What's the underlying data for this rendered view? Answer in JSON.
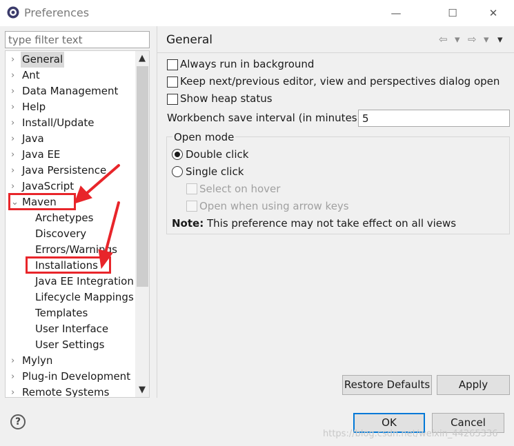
{
  "window": {
    "title": "Preferences",
    "minimize": "—",
    "maximize": "☐",
    "close": "✕"
  },
  "filter": {
    "placeholder": "type filter text"
  },
  "tree": {
    "collapsed_glyph": "›",
    "expanded_glyph": "⌄",
    "items": [
      {
        "label": "General",
        "level": 0,
        "selected": true
      },
      {
        "label": "Ant",
        "level": 0
      },
      {
        "label": "Data Management",
        "level": 0
      },
      {
        "label": "Help",
        "level": 0
      },
      {
        "label": "Install/Update",
        "level": 0
      },
      {
        "label": "Java",
        "level": 0
      },
      {
        "label": "Java EE",
        "level": 0
      },
      {
        "label": "Java Persistence",
        "level": 0
      },
      {
        "label": "JavaScript",
        "level": 0
      },
      {
        "label": "Maven",
        "level": 0,
        "expanded": true
      },
      {
        "label": "Archetypes",
        "level": 1
      },
      {
        "label": "Discovery",
        "level": 1
      },
      {
        "label": "Errors/Warnings",
        "level": 1
      },
      {
        "label": "Installations",
        "level": 1
      },
      {
        "label": "Java EE Integration",
        "level": 1
      },
      {
        "label": "Lifecycle Mappings",
        "level": 1
      },
      {
        "label": "Templates",
        "level": 1
      },
      {
        "label": "User Interface",
        "level": 1
      },
      {
        "label": "User Settings",
        "level": 1
      },
      {
        "label": "Mylyn",
        "level": 0
      },
      {
        "label": "Plug-in Development",
        "level": 0
      },
      {
        "label": "Remote Systems",
        "level": 0
      }
    ],
    "scroll_up": "▲",
    "scroll_down": "▼"
  },
  "page": {
    "title": "General",
    "nav": {
      "back": "⇦",
      "back_menu": "▾",
      "forward": "⇨",
      "forward_menu": "▾",
      "view_menu": "▾"
    },
    "options": {
      "run_in_background": {
        "label": "Always run in background",
        "checked": false
      },
      "keep_editor": {
        "label": "Keep next/previous editor, view and perspectives dialog open",
        "checked": false
      },
      "show_heap": {
        "label": "Show heap status",
        "checked": false
      }
    },
    "save_interval": {
      "label": "Workbench save interval (in minutes):",
      "value": "5"
    },
    "open_mode": {
      "label": "Open mode",
      "double_click": "Double click",
      "single_click": "Single click",
      "selected": "double_click",
      "select_on_hover": "Select on hover",
      "open_arrow_keys": "Open when using arrow keys",
      "note_bold": "Note:",
      "note_text": "This preference may not take effect on all views"
    },
    "restore_defaults": "Restore Defaults",
    "apply": "Apply"
  },
  "footer": {
    "help": "?",
    "ok": "OK",
    "cancel": "Cancel"
  },
  "watermark": "https://blog.csdn.net/weixin_44265336",
  "annotation_color": "#e8252a"
}
